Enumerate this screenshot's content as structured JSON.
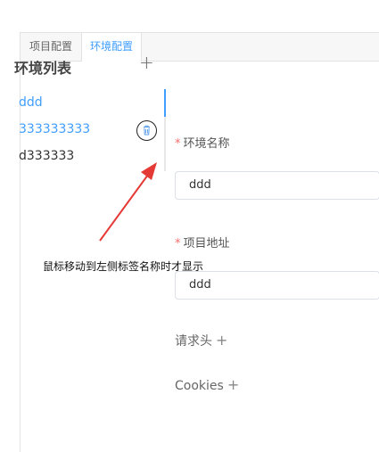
{
  "tabs": [
    {
      "label": "项目配置",
      "active": false
    },
    {
      "label": "环境配置",
      "active": true
    }
  ],
  "env_list": {
    "title": "环境列表",
    "add_symbol": "+",
    "items": [
      "ddd",
      "333333333",
      "d333333"
    ]
  },
  "form": {
    "env_name": {
      "label": "环境名称",
      "required_mark": "*",
      "value": "ddd"
    },
    "project_address": {
      "label": "项目地址",
      "required_mark": "*",
      "value": "ddd"
    },
    "request_header": {
      "label": "请求头",
      "add_symbol": "+"
    },
    "cookies": {
      "label": "Cookies",
      "add_symbol": "+"
    }
  },
  "annotation": {
    "text": "鼠标移动到左侧标签名称时才显示"
  },
  "colors": {
    "accent": "#409eff",
    "required": "#f56c6c",
    "arrow": "#e53935",
    "border": "#dcdfe6"
  },
  "icons": {
    "delete": "trash-icon",
    "arrow": "annotation-arrow"
  }
}
